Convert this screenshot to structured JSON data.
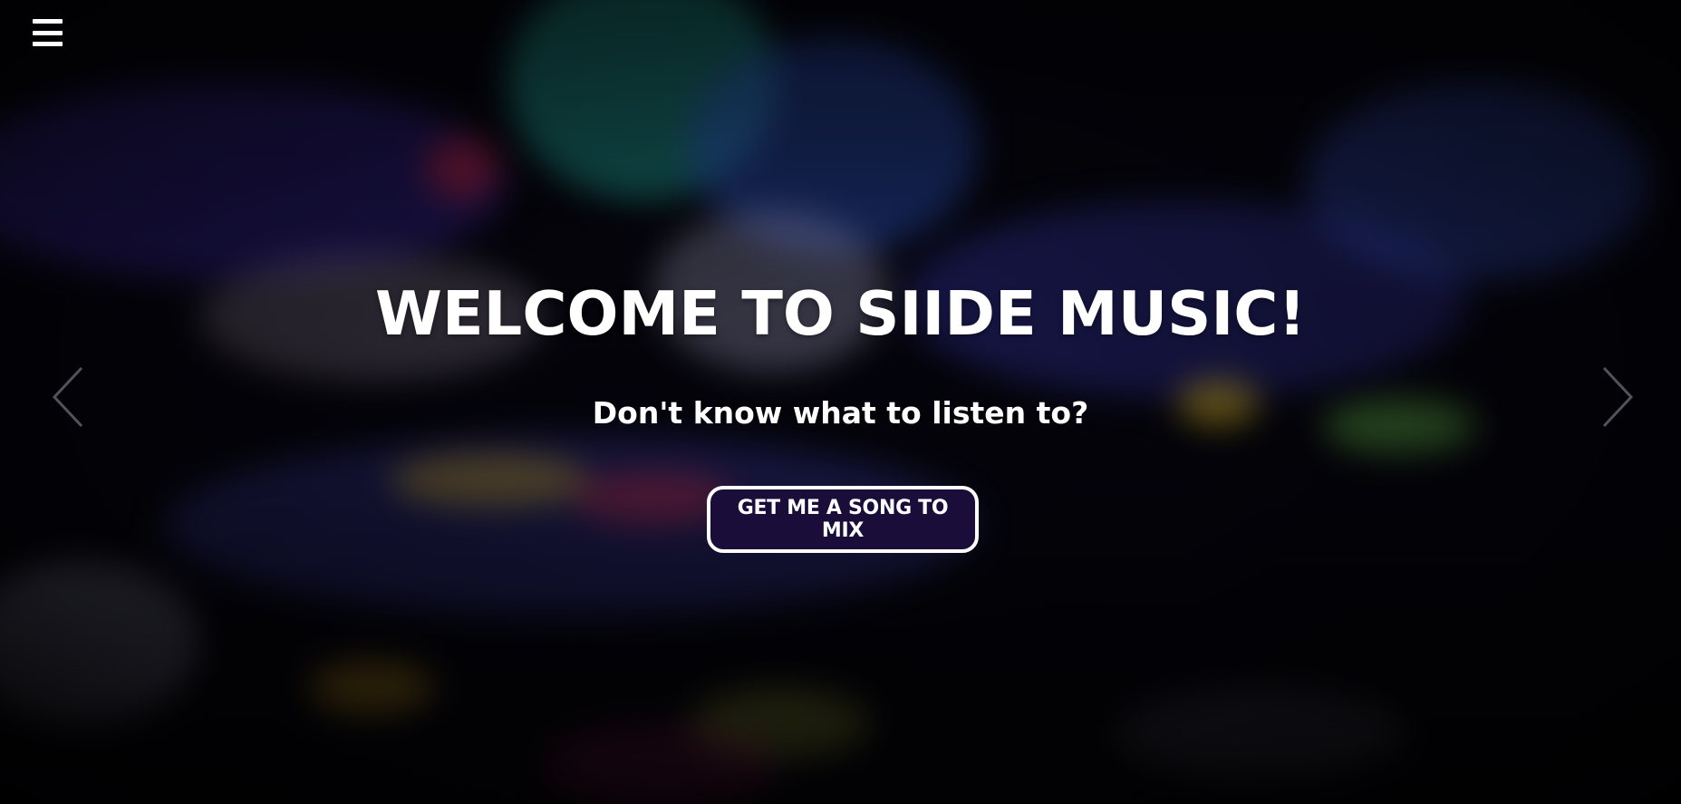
{
  "nav": {
    "menu_icon": "hamburger-menu-icon"
  },
  "hero": {
    "title": "WELCOME TO SIIDE MUSIC!",
    "subtitle": "Don't know what to listen to?",
    "cta_label": "GET ME A SONG TO MIX"
  },
  "carousel": {
    "prev_icon": "chevron-left-icon",
    "next_icon": "chevron-right-icon"
  },
  "colors": {
    "button_background": "#1a0d3a",
    "button_border": "#ffffff",
    "text": "#ffffff"
  }
}
